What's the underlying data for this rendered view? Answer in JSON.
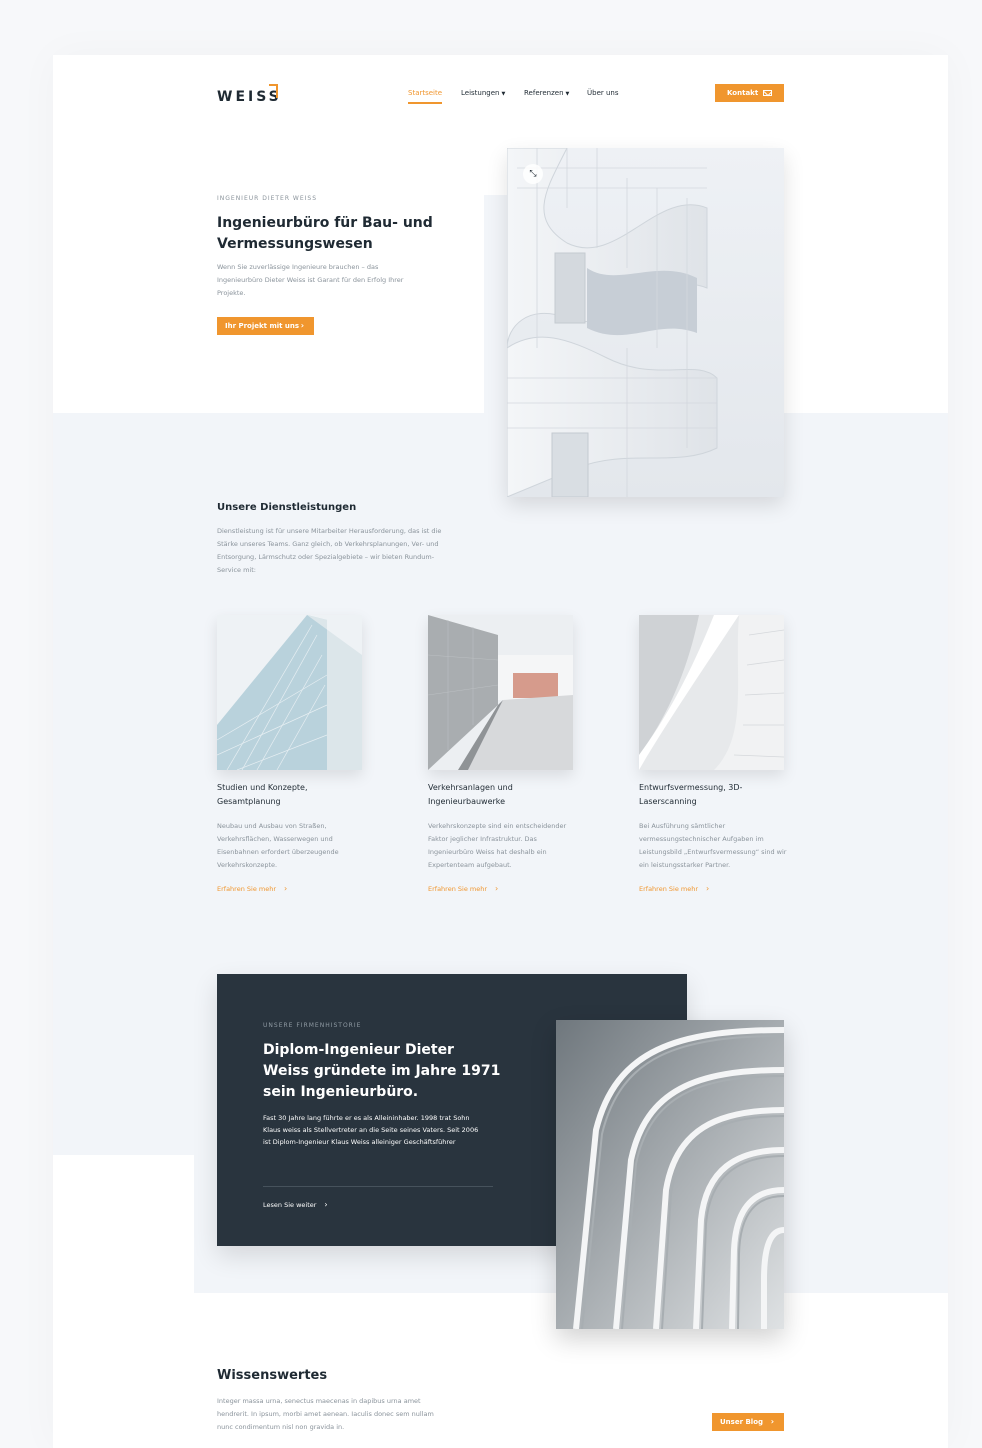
{
  "brand": {
    "logo_text": "WEISS",
    "accent_color": "#f0962e",
    "dark_color": "#29343e"
  },
  "nav": {
    "items": [
      {
        "label": "Startseite",
        "active": true,
        "has_dropdown": false
      },
      {
        "label": "Leistungen",
        "active": false,
        "has_dropdown": true
      },
      {
        "label": "Referenzen",
        "active": false,
        "has_dropdown": true
      },
      {
        "label": "Über uns",
        "active": false,
        "has_dropdown": false
      }
    ],
    "contact_label": "Kontakt",
    "contact_icon": "mail-icon"
  },
  "hero": {
    "eyebrow": "INGENIEUR DIETER WEISS",
    "title": "Ingenieurbüro für Bau- und Vermessungswesen",
    "text": "Wenn Sie zuverlässige Ingenieure brauchen – das Ingenieurbüro Dieter Weiss ist Garant für den Erfolg Ihrer Projekte.",
    "cta_label": "Ihr Projekt mit uns",
    "image_icon": "expand-icon"
  },
  "services": {
    "title": "Unsere Dienstleistungen",
    "text": "Dienstleistung ist für unsere Mitarbeiter Herausforderung, das ist die Stärke unseres Teams. Ganz gleich, ob Verkehrsplanungen, Ver- und Entsorgung, Lärmschutz oder Spezialgebiete – wir bieten Rundum-Service mit:",
    "cards": [
      {
        "title": "Studien und Konzepte, Gesamtplanung",
        "text": "Neubau und Ausbau von Straßen, Verkehrsflächen, Wasserwegen und Eisenbahnen erfordert überzeugende Verkehrskonzepte.",
        "link": "Erfahren Sie mehr"
      },
      {
        "title": "Verkehrsanlagen und Ingenieurbauwerke",
        "text": "Verkehrskonzepte sind ein entscheidender Faktor jeglicher Infrastruktur. Das Ingenieurbüro Weiss hat deshalb ein Expertenteam aufgebaut.",
        "link": "Erfahren Sie mehr"
      },
      {
        "title": "Entwurfsvermessung, 3D-Laserscanning",
        "text": "Bei Ausführung sämtlicher vermessungstechnischer Aufgaben im Leistungsbild „Entwurfsvermessung“ sind wir ein leistungsstarker Partner.",
        "link": "Erfahren Sie mehr"
      }
    ]
  },
  "history": {
    "eyebrow": "UNSERE FIRMENHISTORIE",
    "title": "Diplom-Ingenieur Dieter Weiss gründete im Jahre 1971 sein Ingenieurbüro.",
    "text": "Fast 30 Jahre lang führte er es als Alleininhaber. 1998 trat Sohn Klaus weiss als Stellvertreter an die Seite seines Vaters. Seit 2006 ist Diplom-Ingenieur Klaus Weiss alleiniger Geschäftsführer",
    "link": "Lesen Sie weiter"
  },
  "blog": {
    "title": "Wissenswertes",
    "text": "Integer massa urna, senectus maecenas in dapibus urna amet hendrerit. In ipsum, morbi amet aenean. Iaculis donec sem nullam nunc condimentum nisl non gravida in.",
    "cta_label": "Unser Blog"
  }
}
